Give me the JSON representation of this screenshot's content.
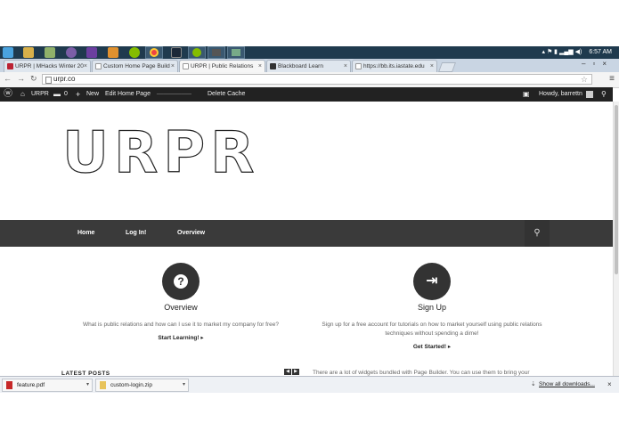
{
  "taskbar": {
    "time": "6:57 AM",
    "apps": [
      "windows-start",
      "file-explorer",
      "notepad",
      "github",
      "visual-studio",
      "sublime",
      "spotify",
      "chrome",
      "steam",
      "spotify-2",
      "media",
      "tool"
    ]
  },
  "tabs": [
    {
      "label": "URPR | MHacks Winter 20",
      "active": false
    },
    {
      "label": "Custom Home Page Build",
      "active": false
    },
    {
      "label": "URPR | Public Relations",
      "active": true
    },
    {
      "label": "Blackboard Learn",
      "active": false
    },
    {
      "label": "https://bb.its.iastate.edu",
      "active": false
    }
  ],
  "address": {
    "url": "urpr.co"
  },
  "adminbar": {
    "site": "URPR",
    "comments_count": "0",
    "new_label": "New",
    "edit_label": "Edit Home Page",
    "delete_cache": "Delete Cache",
    "howdy": "Howdy, barrettn"
  },
  "site": {
    "logo_text": "URPR",
    "nav": [
      "Home",
      "Log In!",
      "Overview"
    ]
  },
  "features": [
    {
      "icon": "?",
      "title": "Overview",
      "text": "What is public relations and how can I use it to market my company for free?",
      "link": "Start Learning! ▸"
    },
    {
      "icon": "⇥",
      "title": "Sign Up",
      "text": "Sign up for a free account for tutorials on how to market yourself using public relations techniques without spending a dime!",
      "link": "Get Started! ▸"
    }
  ],
  "bottom": {
    "latest_posts": "LATEST POSTS",
    "widgets_text": "There are a lot of widgets bundled with Page Builder. You can use them to bring your"
  },
  "downloads": {
    "items": [
      {
        "name": "feature.pdf",
        "type": "pdf"
      },
      {
        "name": "custom-login.zip",
        "type": "zip"
      }
    ],
    "show_all": "Show all downloads..."
  },
  "colors": {
    "taskbar": "#1f3a4e",
    "adminbar": "#222222",
    "mainnav": "#3a3a3a",
    "feature_circle": "#333333"
  }
}
